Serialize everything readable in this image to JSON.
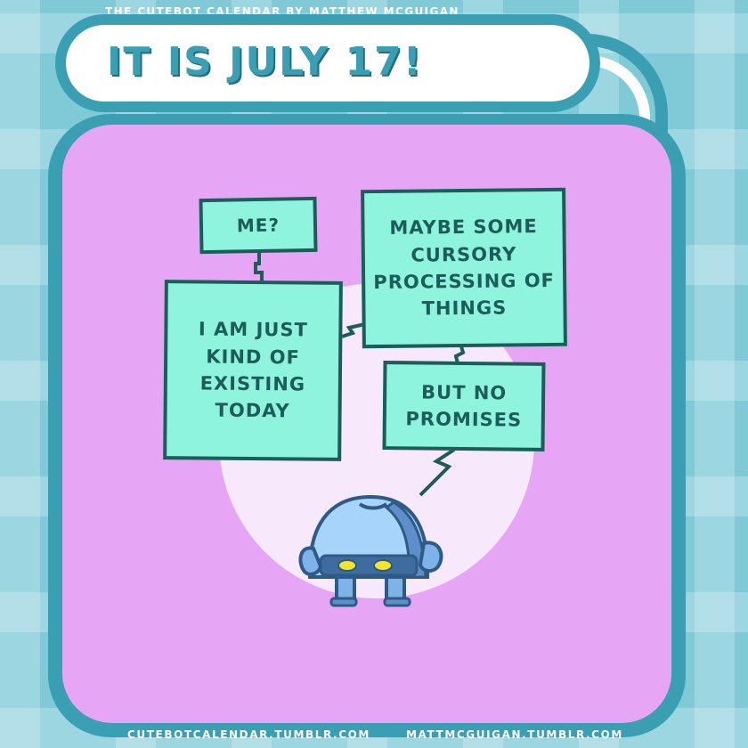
{
  "header": {
    "credit": "The Cutebot Calendar by Matthew McGuigan",
    "title": "It is July 17!"
  },
  "bubbles": {
    "me": "Me?",
    "existing": "I am just kind of existing today",
    "maybe": "Maybe some cursory processing of things",
    "promises": "But no promises"
  },
  "footer": {
    "left_link": "cutebotcalendar.tumblr.com",
    "right_link": "mattmcguigan.tumblr.com"
  },
  "colors": {
    "background": "#8fd8e4",
    "frame": "#3a9fb3",
    "panel": "#e7a6f5",
    "bubble": "#8ff4de",
    "robot": "#7eb2e8"
  }
}
